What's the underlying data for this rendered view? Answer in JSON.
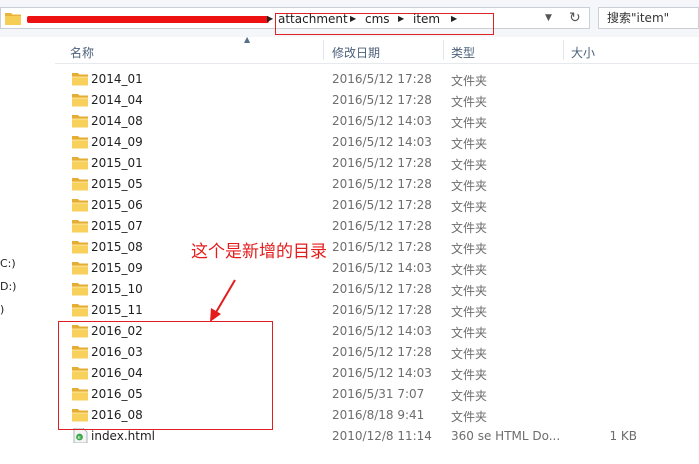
{
  "address": {
    "crumbs": [
      "attachment",
      "cms",
      "item"
    ],
    "search_placeholder": "搜索\"item\""
  },
  "nav": {
    "drives": [
      "C:)",
      "D:)",
      ")"
    ]
  },
  "columns": {
    "name": "名称",
    "date": "修改日期",
    "type": "类型",
    "size": "大小"
  },
  "files": [
    {
      "name": "2014_01",
      "date": "2016/5/12 17:28",
      "type": "文件夹",
      "size": "",
      "icon": "folder-icon"
    },
    {
      "name": "2014_04",
      "date": "2016/5/12 17:28",
      "type": "文件夹",
      "size": "",
      "icon": "folder-icon"
    },
    {
      "name": "2014_08",
      "date": "2016/5/12 14:03",
      "type": "文件夹",
      "size": "",
      "icon": "folder-icon"
    },
    {
      "name": "2014_09",
      "date": "2016/5/12 14:03",
      "type": "文件夹",
      "size": "",
      "icon": "folder-icon"
    },
    {
      "name": "2015_01",
      "date": "2016/5/12 17:28",
      "type": "文件夹",
      "size": "",
      "icon": "folder-icon"
    },
    {
      "name": "2015_05",
      "date": "2016/5/12 17:28",
      "type": "文件夹",
      "size": "",
      "icon": "folder-icon"
    },
    {
      "name": "2015_06",
      "date": "2016/5/12 17:28",
      "type": "文件夹",
      "size": "",
      "icon": "folder-icon"
    },
    {
      "name": "2015_07",
      "date": "2016/5/12 17:28",
      "type": "文件夹",
      "size": "",
      "icon": "folder-icon"
    },
    {
      "name": "2015_08",
      "date": "2016/5/12 17:28",
      "type": "文件夹",
      "size": "",
      "icon": "folder-icon"
    },
    {
      "name": "2015_09",
      "date": "2016/5/12 14:03",
      "type": "文件夹",
      "size": "",
      "icon": "folder-icon"
    },
    {
      "name": "2015_10",
      "date": "2016/5/12 17:28",
      "type": "文件夹",
      "size": "",
      "icon": "folder-icon"
    },
    {
      "name": "2015_11",
      "date": "2016/5/12 17:28",
      "type": "文件夹",
      "size": "",
      "icon": "folder-icon"
    },
    {
      "name": "2016_02",
      "date": "2016/5/12 14:03",
      "type": "文件夹",
      "size": "",
      "icon": "folder-icon"
    },
    {
      "name": "2016_03",
      "date": "2016/5/12 17:28",
      "type": "文件夹",
      "size": "",
      "icon": "folder-icon"
    },
    {
      "name": "2016_04",
      "date": "2016/5/12 14:03",
      "type": "文件夹",
      "size": "",
      "icon": "folder-icon"
    },
    {
      "name": "2016_05",
      "date": "2016/5/31 7:07",
      "type": "文件夹",
      "size": "",
      "icon": "folder-icon"
    },
    {
      "name": "2016_08",
      "date": "2016/8/18 9:41",
      "type": "文件夹",
      "size": "",
      "icon": "folder-icon"
    },
    {
      "name": "index.html",
      "date": "2010/12/8 11:14",
      "type": "360 se HTML Do...",
      "size": "1 KB",
      "icon": "html-file-icon"
    }
  ],
  "annotation": {
    "text": "这个是新增的目录",
    "color": "#e41c1c"
  }
}
